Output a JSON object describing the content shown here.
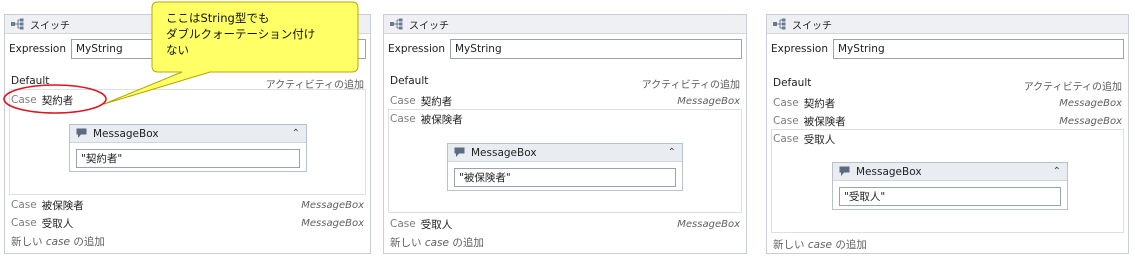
{
  "panels": [
    {
      "title": "スイッチ",
      "expression_label": "Expression",
      "expression_value": "MyString",
      "default_label": "Default",
      "add_activity": "アクティビティの追加",
      "cases": [
        {
          "kw": "Case",
          "value": "契約者",
          "tag": ""
        },
        {
          "kw": "Case",
          "value": "被保険者",
          "tag": "MessageBox"
        },
        {
          "kw": "Case",
          "value": "受取人",
          "tag": "MessageBox"
        }
      ],
      "messagebox": {
        "title": "MessageBox",
        "text": "\"契約者\""
      },
      "new_case_prefix": "新しい",
      "new_case_italic": "case",
      "new_case_suffix": "の追加"
    },
    {
      "title": "スイッチ",
      "expression_label": "Expression",
      "expression_value": "MyString",
      "default_label": "Default",
      "add_activity": "アクティビティの追加",
      "cases": [
        {
          "kw": "Case",
          "value": "契約者",
          "tag": "MessageBox"
        },
        {
          "kw": "Case",
          "value": "被保険者",
          "tag": ""
        },
        {
          "kw": "Case",
          "value": "受取人",
          "tag": "MessageBox"
        }
      ],
      "messagebox": {
        "title": "MessageBox",
        "text": "\"被保険者\""
      },
      "new_case_prefix": "新しい",
      "new_case_italic": "case",
      "new_case_suffix": "の追加"
    },
    {
      "title": "スイッチ",
      "expression_label": "Expression",
      "expression_value": "MyString",
      "default_label": "Default",
      "add_activity": "アクティビティの追加",
      "cases": [
        {
          "kw": "Case",
          "value": "契約者",
          "tag": "MessageBox"
        },
        {
          "kw": "Case",
          "value": "被保険者",
          "tag": "MessageBox"
        },
        {
          "kw": "Case",
          "value": "受取人",
          "tag": ""
        }
      ],
      "messagebox": {
        "title": "MessageBox",
        "text": "\"受取人\""
      },
      "new_case_prefix": "新しい",
      "new_case_italic": "case",
      "new_case_suffix": "の追加"
    }
  ],
  "callout": {
    "line1": "ここはString型でも",
    "line2": "ダブルクォーテーション付け",
    "line3": "ない",
    "fill_color": "#ffff66",
    "border_color": "#b8a800",
    "highlight_color": "#e0141e"
  }
}
